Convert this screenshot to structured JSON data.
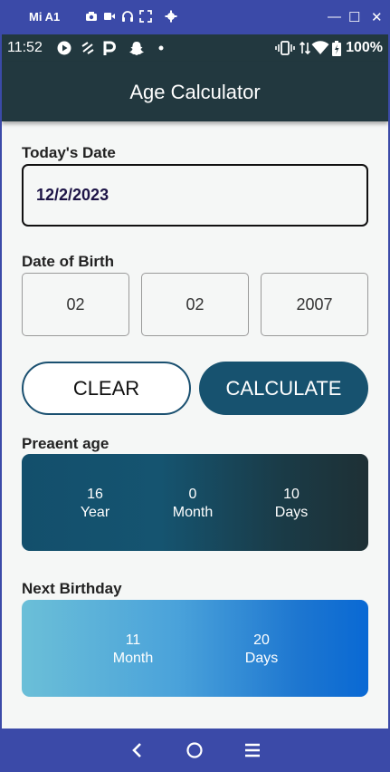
{
  "window": {
    "title": "Mi A1",
    "controls": {
      "minimize": "—",
      "maximize": "☐",
      "close": "✕"
    }
  },
  "status_bar": {
    "time": "11:52",
    "battery": "100%",
    "icons": [
      "play-icon",
      "link-icon",
      "p-icon",
      "snapchat-icon",
      "dot-icon",
      "vibrate-icon",
      "data-icon",
      "wifi-icon",
      "battery-icon"
    ]
  },
  "app_bar": {
    "title": "Age Calculator"
  },
  "today": {
    "label": "Today's Date",
    "value": "12/2/2023"
  },
  "dob": {
    "label": "Date of Birth",
    "day": "02",
    "month": "02",
    "year": "2007"
  },
  "buttons": {
    "clear": "CLEAR",
    "calculate": "CALCULATE"
  },
  "present_age": {
    "label": "Preaent age",
    "years": "16",
    "years_label": "Year",
    "months": "0",
    "months_label": "Month",
    "days": "10",
    "days_label": "Days"
  },
  "next_birthday": {
    "label": "Next Birthday",
    "months": "11",
    "months_label": "Month",
    "days": "20",
    "days_label": "Days"
  },
  "nav": [
    "back-icon",
    "home-icon",
    "menu-icon"
  ],
  "colors": {
    "app_bar": "#22383f",
    "accent": "#17526f",
    "window_frame": "#3b4aa8",
    "next_birthday_gradient_start": "#6bbfd8",
    "next_birthday_gradient_end": "#0969d4"
  }
}
